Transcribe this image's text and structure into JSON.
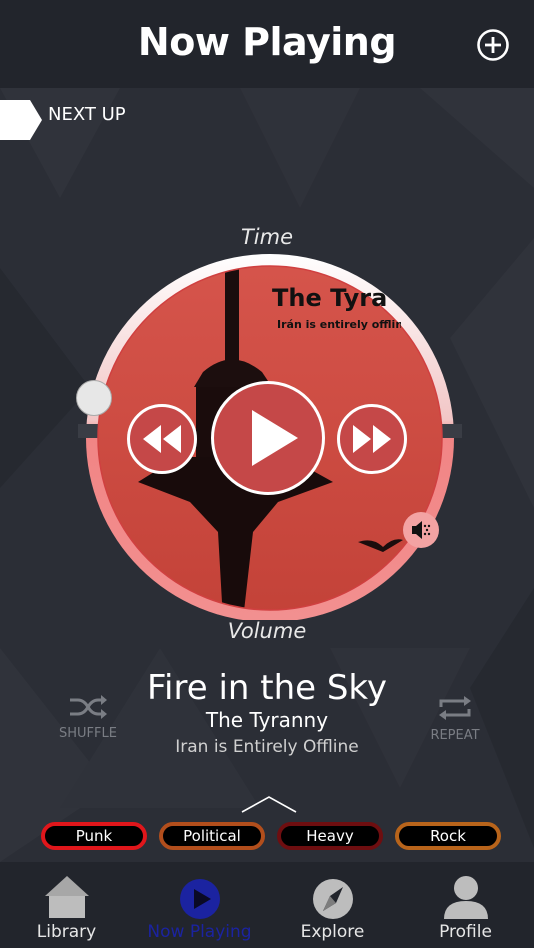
{
  "header": {
    "title": "Now Playing",
    "add_icon": "plus-circle-icon"
  },
  "next_up": {
    "label": "NEXT UP"
  },
  "dial": {
    "time_label": "Time",
    "volume_label": "Volume",
    "time_progress": 0.0,
    "volume_level": 0.62,
    "volume_icon": "speaker-icon",
    "controls": {
      "rewind": "rewind-icon",
      "play": "play-icon",
      "fast_forward": "fast-forward-icon"
    }
  },
  "album_art": {
    "title": "The Tyra",
    "subtitle": "Irán is entirely offline"
  },
  "track": {
    "title": "Fire in the Sky",
    "artist": "The Tyranny",
    "album": "Iran is Entirely Offline"
  },
  "controls": {
    "shuffle": "SHUFFLE",
    "repeat": "REPEAT"
  },
  "tags": [
    {
      "label": "Punk",
      "color": "#e0161b"
    },
    {
      "label": "Political",
      "color": "#b24e1c"
    },
    {
      "label": "Heavy",
      "color": "#6e0e10"
    },
    {
      "label": "Rock",
      "color": "#b8641b"
    }
  ],
  "tabs": [
    {
      "label": "Library",
      "icon": "house-icon"
    },
    {
      "label": "Now Playing",
      "icon": "play-circle-icon",
      "active": true
    },
    {
      "label": "Explore",
      "icon": "compass-icon"
    },
    {
      "label": "Profile",
      "icon": "user-icon"
    }
  ],
  "colors": {
    "accent": "#f08a8a",
    "active_tab": "#1b23a0",
    "background": "#2b2e36",
    "bar": "#22252c"
  }
}
